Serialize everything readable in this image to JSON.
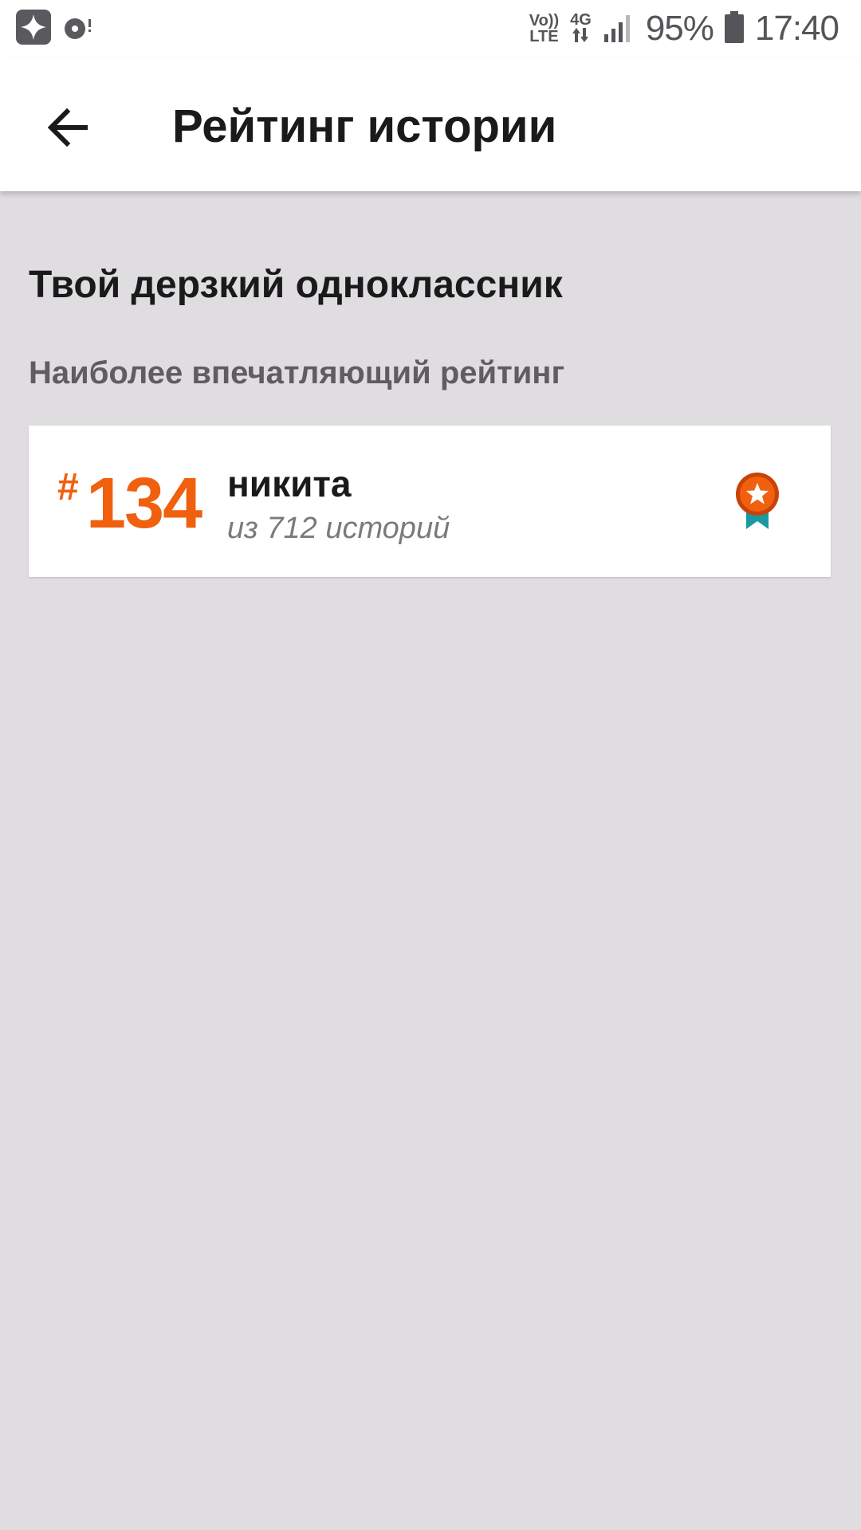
{
  "status_bar": {
    "volte_top": "Vo))",
    "volte_bottom": "LTE",
    "network_type": "4G",
    "battery": "95%",
    "time": "17:40",
    "icons": [
      "app-notification-icon",
      "sync-notification-icon",
      "data-arrows-icon",
      "signal-icon",
      "battery-icon"
    ]
  },
  "toolbar": {
    "back_icon": "arrow-left-icon",
    "title": "Рейтинг истории"
  },
  "story": {
    "title": "Твой дерзкий одноклассник",
    "section_title": "Наиболее впечатляющий рейтинг"
  },
  "rating": {
    "hash": "#",
    "rank": "134",
    "name": "никита",
    "total_text": "из 712 историй",
    "badge_icon": "medal-star-icon"
  },
  "colors": {
    "accent": "#f0600e",
    "medal_ribbon": "#1a9aa0",
    "background": "#dfdde0",
    "surface": "#ffffff"
  }
}
